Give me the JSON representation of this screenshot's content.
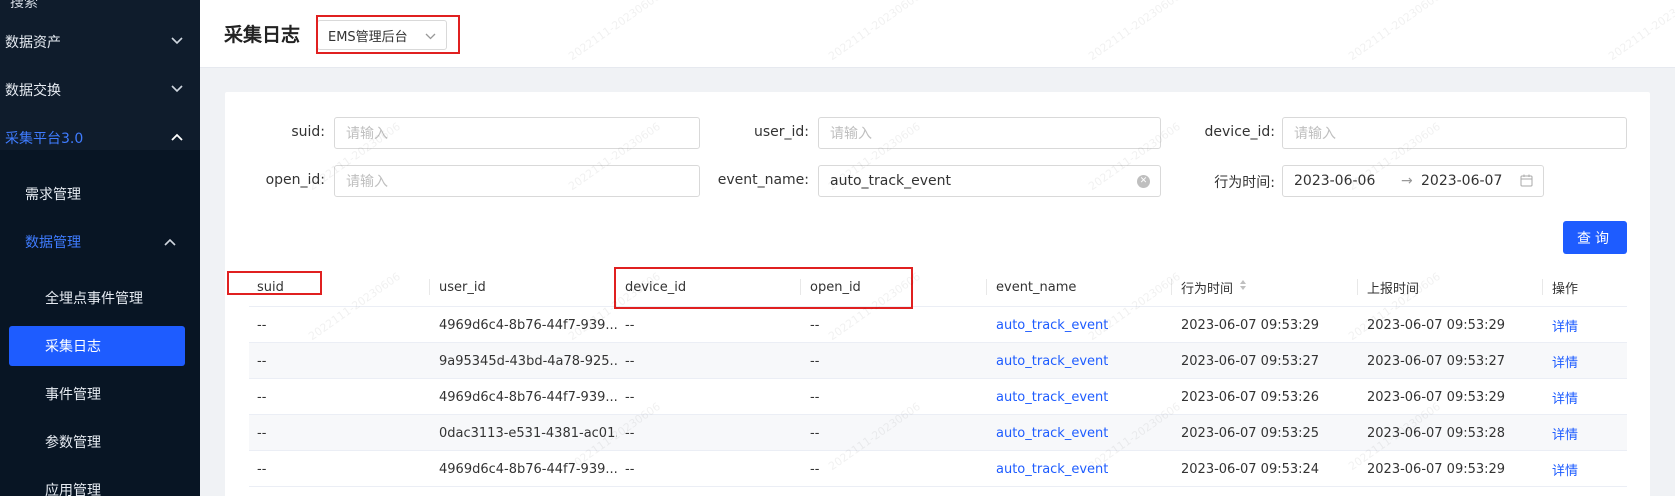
{
  "sidebar": {
    "cutoff_label": "搜索",
    "items": [
      {
        "label": "数据资产"
      },
      {
        "label": "数据交换"
      },
      {
        "label": "采集平台3.0"
      }
    ],
    "sub": [
      {
        "label": "需求管理"
      },
      {
        "label": "数据管理"
      }
    ],
    "leaves": [
      {
        "label": "全埋点事件管理"
      },
      {
        "label": "采集日志"
      },
      {
        "label": "事件管理"
      },
      {
        "label": "参数管理"
      },
      {
        "label": "应用管理"
      }
    ]
  },
  "header": {
    "title": "采集日志",
    "app_select": "EMS管理后台"
  },
  "filters": {
    "suid": {
      "label": "suid:",
      "placeholder": "请输入"
    },
    "user_id": {
      "label": "user_id:",
      "placeholder": "请输入"
    },
    "device_id": {
      "label": "device_id:",
      "placeholder": "请输入"
    },
    "open_id": {
      "label": "open_id:",
      "placeholder": "请输入"
    },
    "event_name": {
      "label": "event_name:",
      "value": "auto_track_event"
    },
    "time": {
      "label": "行为时间:",
      "start": "2023-06-06",
      "end": "2023-06-07"
    }
  },
  "query_label": "查询",
  "table": {
    "columns": [
      "suid",
      "user_id",
      "device_id",
      "open_id",
      "event_name",
      "行为时间",
      "上报时间",
      "操作"
    ],
    "rows": [
      {
        "suid": "--",
        "user_id": "4969d6c4-8b76-44f7-939...",
        "device_id": "--",
        "open_id": "--",
        "event_name": "auto_track_event",
        "action_time": "2023-06-07 09:53:29",
        "report_time": "2023-06-07 09:53:29",
        "op": "详情"
      },
      {
        "suid": "--",
        "user_id": "9a95345d-43bd-4a78-925...",
        "device_id": "--",
        "open_id": "--",
        "event_name": "auto_track_event",
        "action_time": "2023-06-07 09:53:27",
        "report_time": "2023-06-07 09:53:27",
        "op": "详情"
      },
      {
        "suid": "--",
        "user_id": "4969d6c4-8b76-44f7-939...",
        "device_id": "--",
        "open_id": "--",
        "event_name": "auto_track_event",
        "action_time": "2023-06-07 09:53:26",
        "report_time": "2023-06-07 09:53:29",
        "op": "详情"
      },
      {
        "suid": "--",
        "user_id": "0dac3113-e531-4381-ac01...",
        "device_id": "--",
        "open_id": "--",
        "event_name": "auto_track_event",
        "action_time": "2023-06-07 09:53:25",
        "report_time": "2023-06-07 09:53:28",
        "op": "详情"
      },
      {
        "suid": "--",
        "user_id": "4969d6c4-8b76-44f7-939...",
        "device_id": "--",
        "open_id": "--",
        "event_name": "auto_track_event",
        "action_time": "2023-06-07 09:53:24",
        "report_time": "2023-06-07 09:53:29",
        "op": "详情"
      }
    ]
  },
  "watermark": "2022111-20230606",
  "colors": {
    "primary": "#1e5cff",
    "sidebar_bg": "#0f1c2c",
    "highlight": "#e02020"
  }
}
